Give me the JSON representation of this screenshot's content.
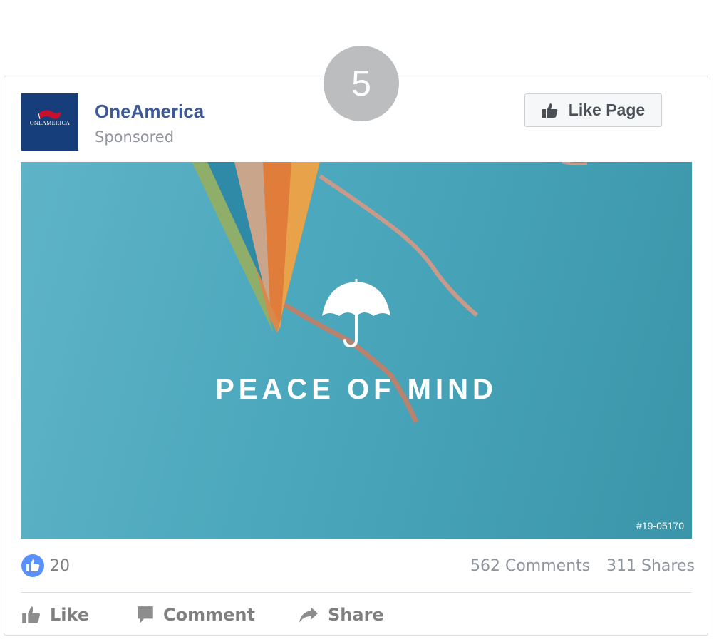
{
  "step_badge": "5",
  "post": {
    "logo_text": "ONEAMERICA",
    "page_name": "OneAmerica",
    "sponsored_label": "Sponsored",
    "like_page_label": "Like Page"
  },
  "hero": {
    "title": "PEACE OF MIND",
    "code": "#19-05170",
    "icon": "umbrella-icon"
  },
  "stats": {
    "likes": "20",
    "comments": "562 Comments",
    "shares": "311 Shares"
  },
  "actions": {
    "like": "Like",
    "comment": "Comment",
    "share": "Share"
  },
  "colors": {
    "brand": "#3b5998",
    "logo_bg": "#163e7a",
    "hero_bg": "#4aa7bc",
    "badge": "#bcbdbf",
    "reaction_blue": "#5890ff",
    "muted": "#90949c"
  }
}
